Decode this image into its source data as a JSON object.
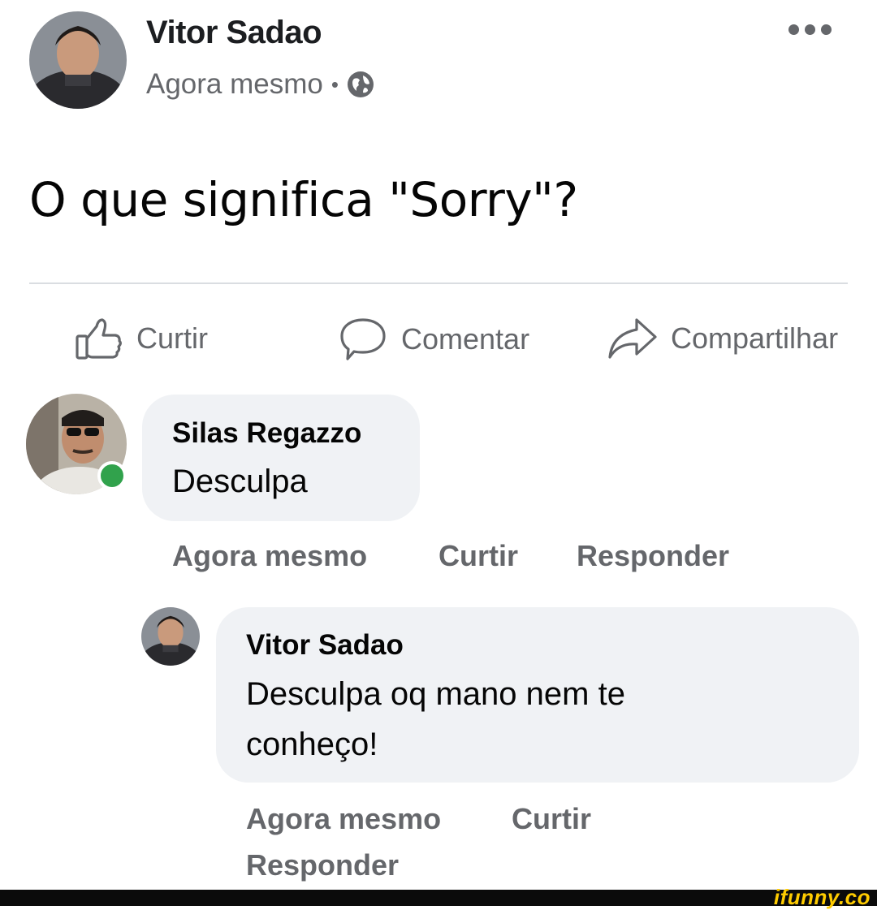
{
  "post": {
    "author": "Vitor Sadao",
    "time": "Agora mesmo",
    "separator": "•",
    "privacy_icon": "globe-icon",
    "more_icon": "more-options-icon",
    "text": "O que significa \"Sorry\"?"
  },
  "actions": {
    "like": "Curtir",
    "comment": "Comentar",
    "share": "Compartilhar"
  },
  "comments": [
    {
      "author": "Silas Regazzo",
      "text": "Desculpa",
      "online": true,
      "time": "Agora mesmo",
      "like": "Curtir",
      "reply": "Responder"
    },
    {
      "author": "Vitor Sadao",
      "text_line1": "Desculpa oq mano nem te",
      "text_line2": "conheço!",
      "time": "Agora mesmo",
      "like": "Curtir",
      "reply": "Responder"
    }
  ],
  "watermark": "ifunny.co",
  "colors": {
    "secondary_text": "#65676b",
    "bubble": "#f0f2f5",
    "online": "#31a24c",
    "watermark": "#ffcc00"
  }
}
